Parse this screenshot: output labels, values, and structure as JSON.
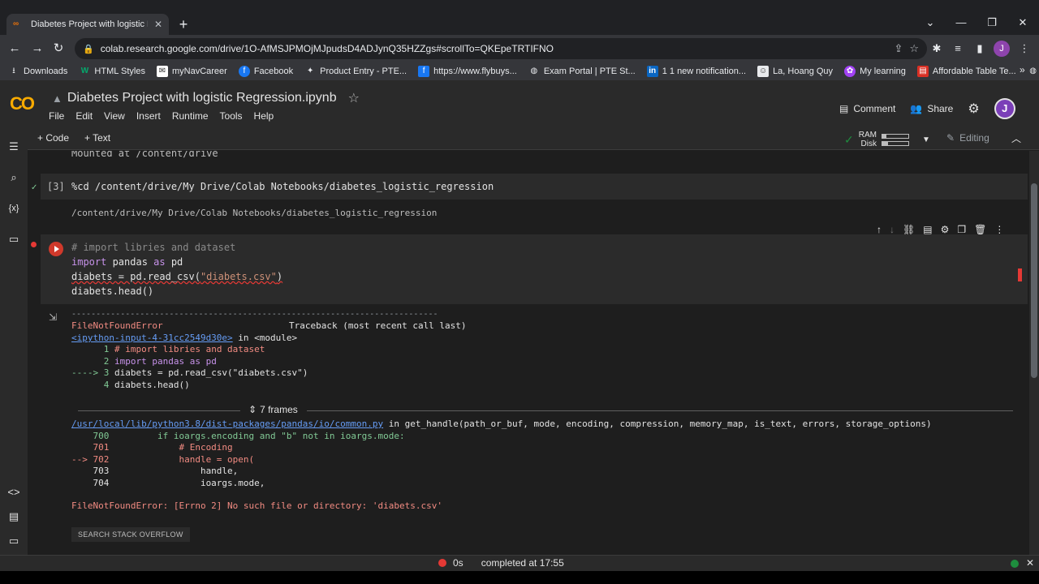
{
  "browser": {
    "tab_title": "Diabetes Project with logistic Re...",
    "url": "colab.research.google.com/drive/1O-AfMSJPMOjMJpudsD4ADJynQ35HZZgs#scrollTo=QKEpeTRTIFNO",
    "profile_initial": "J",
    "bookmarks": [
      {
        "label": "Downloads",
        "icon": "download-icon"
      },
      {
        "label": "HTML Styles",
        "icon": "w3-icon"
      },
      {
        "label": "myNavCareer",
        "icon": "gmail-icon"
      },
      {
        "label": "Facebook",
        "icon": "facebook-icon"
      },
      {
        "label": "Product Entry - PTE...",
        "icon": "puzzle-icon"
      },
      {
        "label": "https://www.flybuys...",
        "icon": "facebook-icon"
      },
      {
        "label": "Exam Portal | PTE St...",
        "icon": "globe-icon"
      },
      {
        "label": "1 1 new notification...",
        "icon": "linkedin-icon"
      },
      {
        "label": "La, Hoang Quy",
        "icon": "person-icon"
      },
      {
        "label": "My learning",
        "icon": "learning-icon"
      },
      {
        "label": "Affordable Table Te...",
        "icon": "table-icon"
      }
    ]
  },
  "colab": {
    "logo": "CO",
    "notebook_title": "Diabetes Project with logistic Regression.ipynb",
    "menu": [
      "File",
      "Edit",
      "View",
      "Insert",
      "Runtime",
      "Tools",
      "Help"
    ],
    "comment_label": "Comment",
    "share_label": "Share",
    "avatar_initial": "J",
    "add_code_label": "+ Code",
    "add_text_label": "+ Text",
    "ram_label": "RAM",
    "disk_label": "Disk",
    "ram_fraction": 0.15,
    "disk_fraction": 0.22,
    "editing_label": "Editing"
  },
  "cells": {
    "prev_output": "Mounted at /content/drive",
    "cell3": {
      "exec_count": "[3]",
      "code": "%cd /content/drive/My Drive/Colab Notebooks/diabetes_logistic_regression",
      "output": "/content/drive/My Drive/Colab Notebooks/diabetes_logistic_regression"
    },
    "cell4": {
      "line1": "# import libries and dataset",
      "line2_kw": "import",
      "line2_mod": " pandas ",
      "line2_kw2": "as",
      "line2_alias": " pd",
      "line3_a": "diabets = pd.read_csv(",
      "line3_str": "\"diabets.csv\"",
      "line3_b": ")",
      "line4": "diabets.head()"
    },
    "traceback": {
      "dashes": "---------------------------------------------------------------------------",
      "error_name": "FileNotFoundError",
      "header_right": "Traceback (most recent call last)",
      "input_link": "<ipython-input-4-31cc2549d30e>",
      "in_module": " in <module>",
      "t1_num": "      1 ",
      "t1": "# import libries and dataset",
      "t2_num": "      2 ",
      "t2": "import pandas as pd",
      "t3_num": "----> 3 ",
      "t3": "diabets = pd.read_csv(\"diabets.csv\")",
      "t4_num": "      4 ",
      "t4": "diabets.head()",
      "frames_label": "7 frames",
      "file_link": "/usr/local/lib/python3.8/dist-packages/pandas/io/common.py",
      "in_func": " in get_handle(path_or_buf, mode, encoding, compression, memory_map, is_text, errors, storage_options)",
      "l700": "    700         if ioargs.encoding and \"b\" not in ioargs.mode:",
      "l701": "    701             # Encoding",
      "l702": "--> 702             handle = open(",
      "l703": "    703                 handle,",
      "l704": "    704                 ioargs.mode,",
      "final_error": "FileNotFoundError: [Errno 2] No such file or directory: 'diabets.csv'",
      "stack_button": "SEARCH STACK OVERFLOW"
    }
  },
  "status": {
    "duration": "0s",
    "completed": "completed at 17:55"
  },
  "colors": {
    "error_dot": "#e53935",
    "ok_dot": "#1e8e3e"
  }
}
